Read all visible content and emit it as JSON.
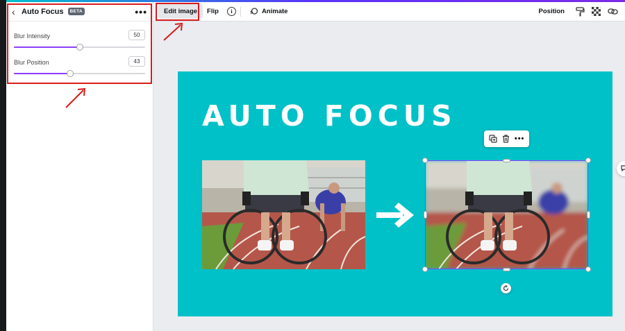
{
  "panel": {
    "back_icon": "chevron-left-icon",
    "title": "Auto Focus",
    "badge": "BETA",
    "more_icon": "more-horizontal-icon",
    "controls": [
      {
        "label": "Blur Intensity",
        "value": "50",
        "level": 0.5
      },
      {
        "label": "Blur Position",
        "value": "43",
        "level": 0.43
      }
    ]
  },
  "toolbar": {
    "edit_image": "Edit image",
    "flip": "Flip",
    "info": "i",
    "animate": "Animate",
    "position": "Position"
  },
  "design": {
    "title": "AUTO FOCUS"
  },
  "colors": {
    "accent": "#8b3dff",
    "canvas_bg": "#00c1c8",
    "annotation": "#d81b1b"
  }
}
